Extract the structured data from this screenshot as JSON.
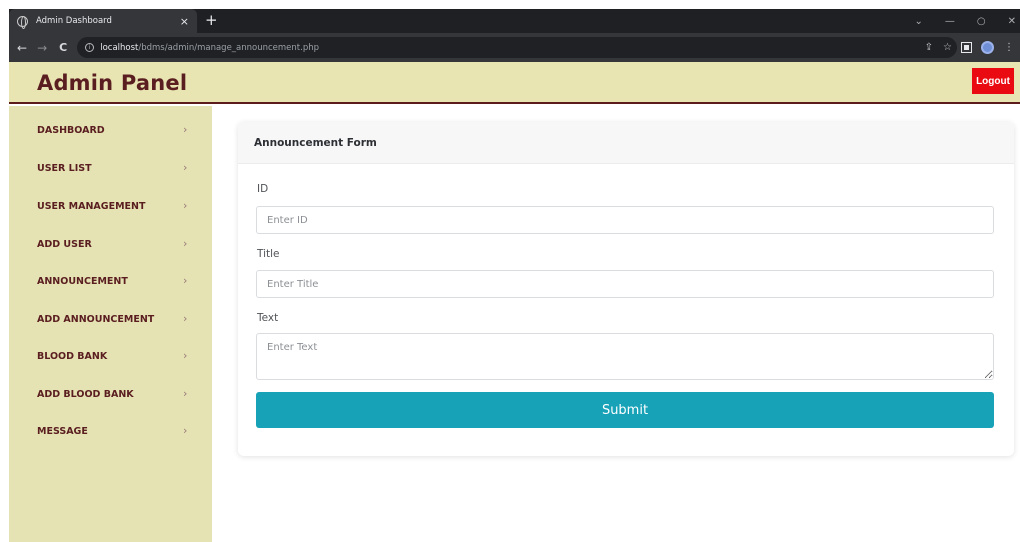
{
  "browser": {
    "tab_title": "Admin Dashboard",
    "tab_close": "×",
    "new_tab": "+",
    "url_host": "localhost",
    "url_path": "/bdms/admin/manage_announcement.php",
    "window_controls": [
      "⌄",
      "—",
      "○",
      "✕"
    ]
  },
  "header": {
    "brand": "Admin Panel",
    "logout_label": "Logout"
  },
  "sidebar": {
    "items": [
      {
        "label": "DASHBOARD"
      },
      {
        "label": "USER LIST"
      },
      {
        "label": "USER MANAGEMENT"
      },
      {
        "label": "ADD USER"
      },
      {
        "label": "ANNOUNCEMENT"
      },
      {
        "label": "ADD ANNOUNCEMENT"
      },
      {
        "label": "BLOOD BANK"
      },
      {
        "label": "ADD BLOOD BANK"
      },
      {
        "label": "MESSAGE"
      }
    ],
    "chevron": "›"
  },
  "form": {
    "title": "Announcement Form",
    "id_label": "ID",
    "id_placeholder": "Enter ID",
    "title_label": "Title",
    "title_placeholder": "Enter Title",
    "text_label": "Text",
    "text_placeholder": "Enter Text",
    "submit_label": "Submit"
  },
  "colors": {
    "header_bg": "#e8e5b2",
    "brand": "#5a1d20",
    "logout": "#ea0b12",
    "submit": "#17a2b8"
  }
}
